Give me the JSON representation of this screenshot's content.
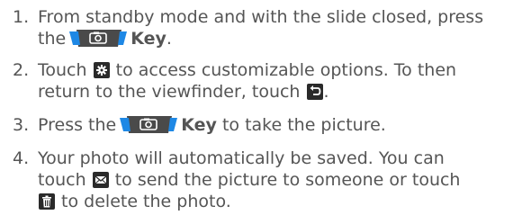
{
  "steps": [
    {
      "number": "1.",
      "line1": "From standby mode and with the slide closed, press",
      "line2_pre": "the",
      "key_label": "Key",
      "line2_post": "."
    },
    {
      "number": "2.",
      "line1_pre": "Touch",
      "line1_post": "to access customizable options. To then",
      "line2_pre": "return to the viewfinder, touch",
      "line2_post": "."
    },
    {
      "number": "3.",
      "pre": "Press the",
      "key_label": "Key",
      "post": "to take the picture."
    },
    {
      "number": "4.",
      "line1": "Your photo will automatically be saved. You can",
      "line2_pre": "touch",
      "line2_post": "to send the picture to someone or touch",
      "line3_post": "to delete the photo."
    }
  ],
  "icons": {
    "camera_key": "camera-key-icon",
    "settings": "gear-icon",
    "back": "back-arrow-icon",
    "send": "envelope-icon",
    "delete": "trash-icon"
  },
  "colors": {
    "text": "#555555",
    "key_fill": "#4a4a4a",
    "key_accent": "#1e88e5",
    "icon_bg": "#2a2a2a"
  }
}
